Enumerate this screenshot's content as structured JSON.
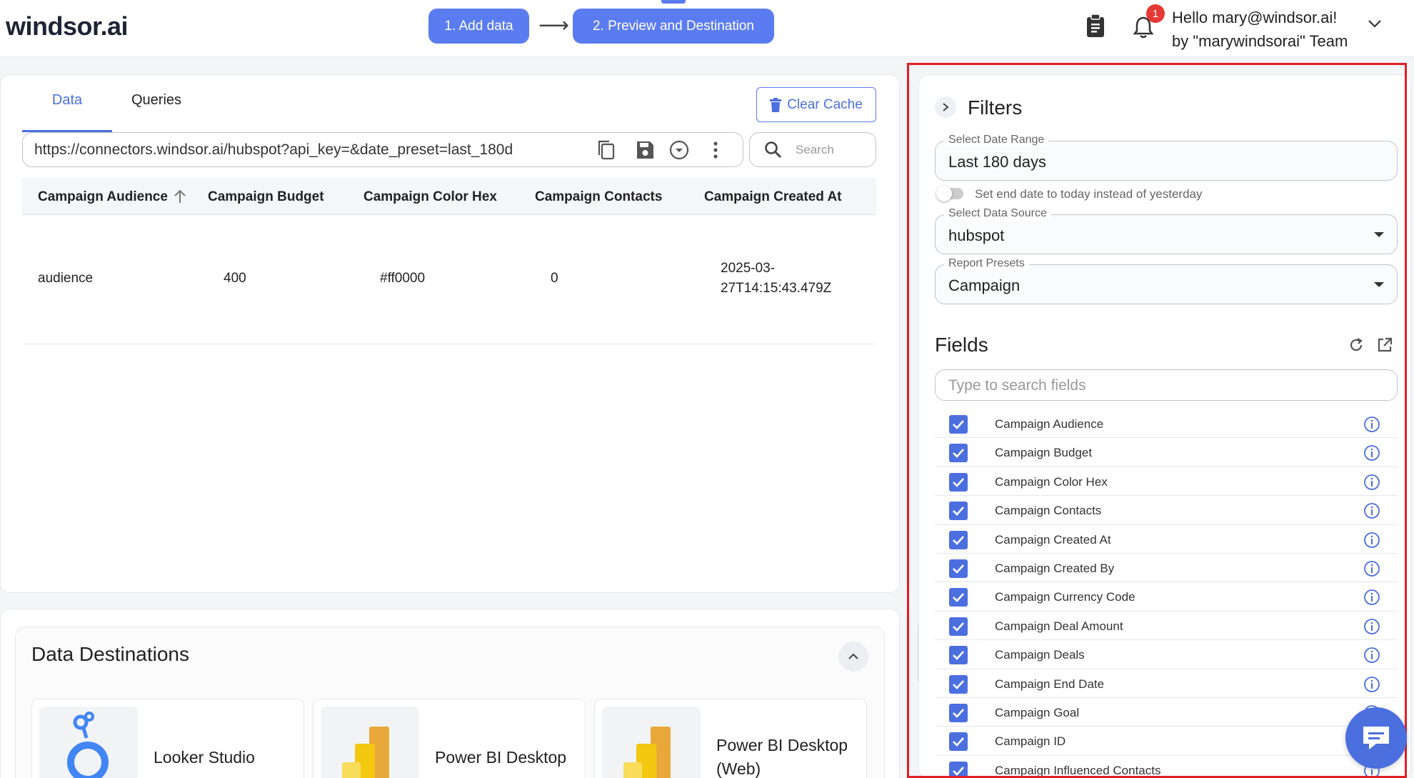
{
  "header": {
    "logo": "windsor.ai",
    "steps": [
      "1. Add data",
      "2. Preview and Destination"
    ],
    "notification_count": "1",
    "greeting": "Hello mary@windsor.ai!",
    "team": "by \"marywindsorai\" Team"
  },
  "main": {
    "tabs": [
      "Data",
      "Queries"
    ],
    "clear_cache": "Clear Cache",
    "url": "https://connectors.windsor.ai/hubspot?api_key=&date_preset=last_180d",
    "search_placeholder": "Search",
    "table": {
      "columns": [
        "Campaign Audience",
        "Campaign Budget",
        "Campaign Color Hex",
        "Campaign Contacts",
        "Campaign Created At"
      ],
      "rows": [
        [
          "audience",
          "400",
          "#ff0000",
          "0",
          "2025-03-",
          "27T14:15:43.479Z"
        ]
      ]
    }
  },
  "destinations": {
    "title": "Data Destinations",
    "items": [
      {
        "name": "Looker Studio"
      },
      {
        "name": "Power BI Desktop"
      },
      {
        "name_line1": "Power BI Desktop",
        "name_line2": "(Web)"
      }
    ]
  },
  "filters": {
    "title": "Filters",
    "date_range_label": "Select Date Range",
    "date_range_value": "Last 180 days",
    "toggle_label": "Set end date to today instead of yesterday",
    "data_source_label": "Select Data Source",
    "data_source_value": "hubspot",
    "report_presets_label": "Report Presets",
    "report_presets_value": "Campaign"
  },
  "fields": {
    "title": "Fields",
    "search_placeholder": "Type to search fields",
    "items": [
      "Campaign Audience",
      "Campaign Budget",
      "Campaign Color Hex",
      "Campaign Contacts",
      "Campaign Created At",
      "Campaign Created By",
      "Campaign Currency Code",
      "Campaign Deal Amount",
      "Campaign Deals",
      "Campaign End Date",
      "Campaign Goal",
      "Campaign ID",
      "Campaign Influenced Contacts"
    ]
  },
  "colors": {
    "accent": "#5b7cf0",
    "highlight_frame": "#e01f26"
  }
}
